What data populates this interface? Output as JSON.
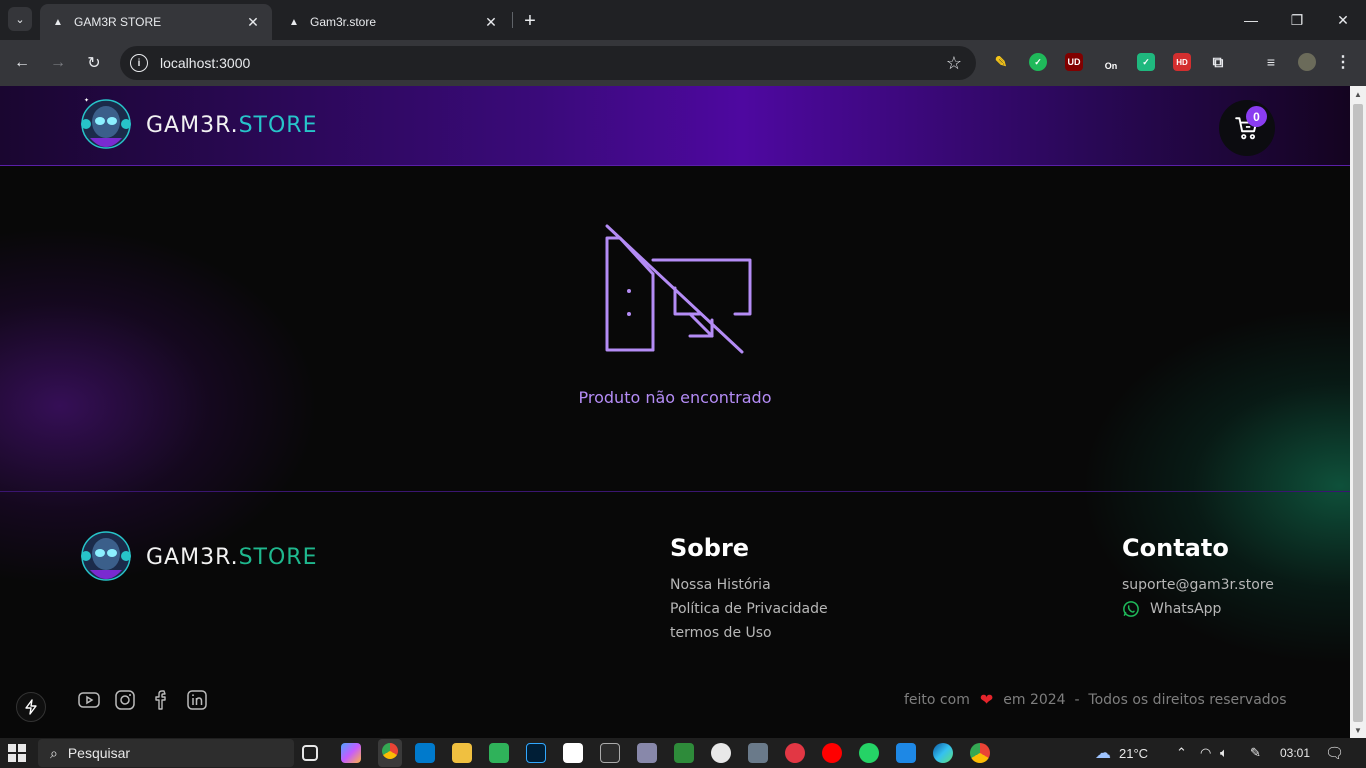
{
  "browser": {
    "tabs": [
      {
        "title": "GAM3R STORE",
        "active": true
      },
      {
        "title": "Gam3r.store",
        "active": false
      }
    ],
    "url": "localhost:3000",
    "extensions": [
      {
        "name": "paint-extension-icon",
        "color": "#f5c518",
        "label": ""
      },
      {
        "name": "check-extension-icon",
        "color": "#1fb95a",
        "label": "✓"
      },
      {
        "name": "ublock-extension-icon",
        "color": "#800000",
        "label": "UD"
      },
      {
        "name": "toggle-extension-icon",
        "color": "#35363a",
        "label": "On"
      },
      {
        "name": "shield-extension-icon",
        "color": "#1fb87e",
        "label": "✓"
      },
      {
        "name": "hd-extension-icon",
        "color": "#d32f2f",
        "label": "HD"
      }
    ]
  },
  "header": {
    "brand_main": "GAM3R.",
    "brand_accent": "STORE",
    "cart_count": "0"
  },
  "main": {
    "message": "Produto não encontrado"
  },
  "footer": {
    "brand_main": "GAM3R.",
    "brand_accent": "STORE",
    "about": {
      "title": "Sobre",
      "links": [
        "Nossa História",
        "Política de Privacidade",
        "termos de Uso"
      ]
    },
    "contact": {
      "title": "Contato",
      "email": "suporte@gam3r.store",
      "whatsapp": "WhatsApp"
    },
    "copyright": {
      "prefix": "feito com",
      "suffix": "em 2024  -  Todos os direitos reservados"
    }
  },
  "taskbar": {
    "search_placeholder": "Pesquisar",
    "weather": "21°C",
    "time": "03:01"
  },
  "colors": {
    "accent_purple": "#8a3df0",
    "accent_teal": "#27c4c9",
    "message_purple": "#b48cf5",
    "heart_red": "#e5242b"
  }
}
